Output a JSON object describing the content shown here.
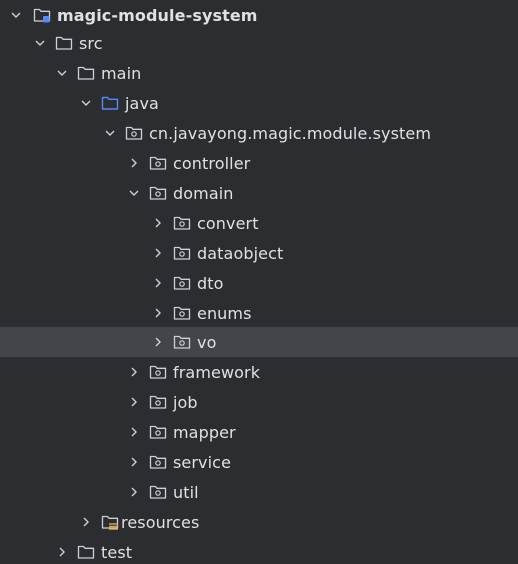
{
  "colors": {
    "background": "#2b2d30",
    "selected_row": "#43454a",
    "text": "#dfe1e5",
    "folder_stroke": "#ced0d6",
    "source_folder_stroke": "#548af7",
    "module_accent": "#548af7",
    "resources_accent": "#d6ae58"
  },
  "tree": {
    "root": {
      "label": "magic-module-system",
      "icon": "module-folder-icon"
    },
    "src": {
      "label": "src"
    },
    "main": {
      "label": "main"
    },
    "java": {
      "label": "java",
      "icon": "source-root-folder-icon"
    },
    "package": {
      "label": "cn.javayong.magic.module.system",
      "icon": "package-icon"
    },
    "controller": {
      "label": "controller"
    },
    "domain": {
      "label": "domain"
    },
    "convert": {
      "label": "convert"
    },
    "dataobject": {
      "label": "dataobject"
    },
    "dto": {
      "label": "dto"
    },
    "enums": {
      "label": "enums"
    },
    "vo": {
      "label": "vo",
      "selected": true
    },
    "framework": {
      "label": "framework"
    },
    "job": {
      "label": "job"
    },
    "mapper": {
      "label": "mapper"
    },
    "service": {
      "label": "service"
    },
    "util": {
      "label": "util"
    },
    "resources": {
      "label": "resources",
      "icon": "resources-root-folder-icon"
    },
    "test": {
      "label": "test"
    }
  }
}
